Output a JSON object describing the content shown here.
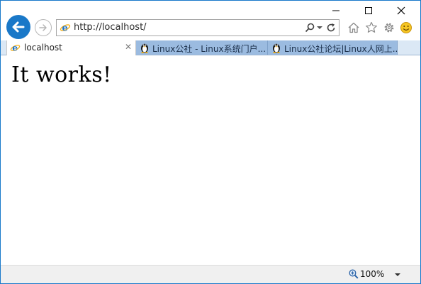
{
  "address_bar": {
    "url": "http://localhost/"
  },
  "tabs": [
    {
      "title": "localhost",
      "active": true
    },
    {
      "title": "Linux公社 - Linux系统门户...",
      "active": false
    },
    {
      "title": "Linux公社论坛|Linux人网上...",
      "active": false
    }
  ],
  "page": {
    "heading": "It works!"
  },
  "status_bar": {
    "zoom": "100%"
  },
  "colors": {
    "accent": "#1a78c8",
    "tab_inactive": "#9bbbe0",
    "frame": "#1979ca"
  },
  "icons": [
    "back-arrow-icon",
    "forward-arrow-icon",
    "ie-logo-icon",
    "search-icon",
    "refresh-icon",
    "home-icon",
    "star-icon",
    "gear-icon",
    "smiley-icon",
    "tux-icon",
    "zoom-icon"
  ]
}
